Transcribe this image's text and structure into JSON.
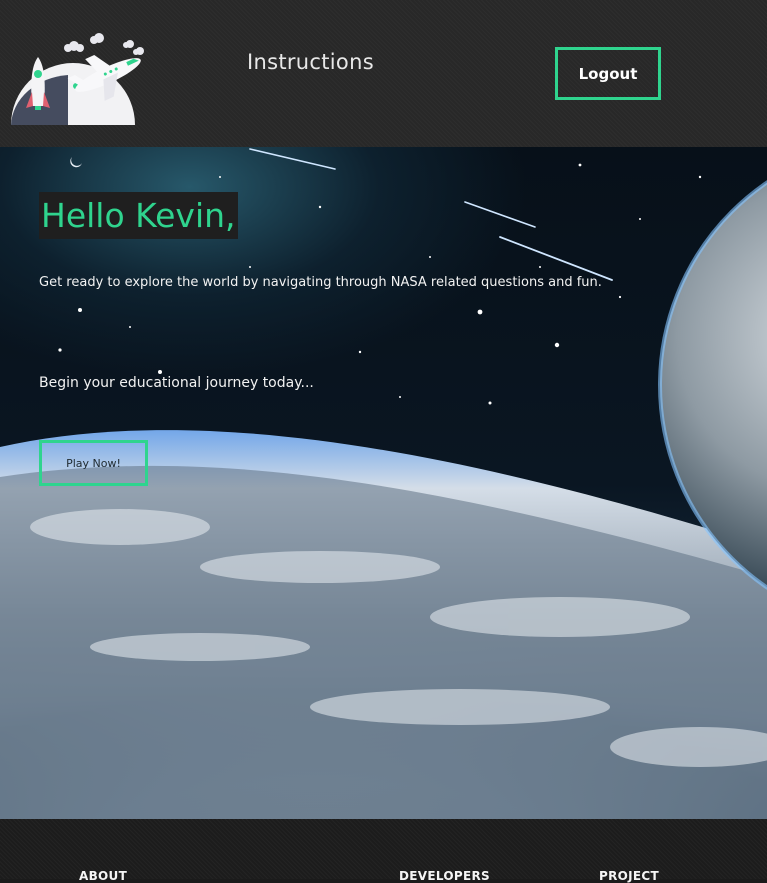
{
  "header": {
    "logo_icon": "rocket-astronaut-airplane-icon",
    "nav": {
      "instructions_label": "Instructions"
    },
    "logout_label": "Logout"
  },
  "hero": {
    "greeting": "Hello Kevin,",
    "tagline": "Get ready to explore the world by navigating through NASA related questions and fun.",
    "subtagline": "Begin your educational journey today...",
    "play_label": "Play Now!",
    "background_image": "earth-from-space-image"
  },
  "footer": {
    "about_heading": "ABOUT",
    "developers_heading": "DEVELOPERS",
    "project_heading": "PROJECT"
  },
  "colors": {
    "accent": "#2fd48e",
    "header_bg": "#282828",
    "footer_bg": "#1c1c1c",
    "text_light": "#f2f2f2"
  }
}
